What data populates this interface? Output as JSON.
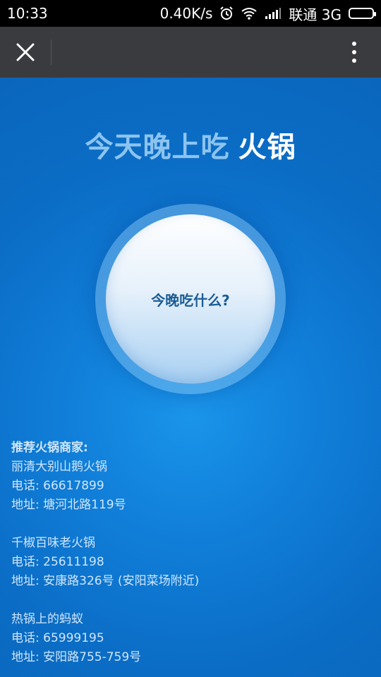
{
  "status_bar": {
    "time": "10:33",
    "speed": "0.40K/s",
    "carrier": "联通 3G"
  },
  "app_bar": {
    "close_icon": "close-icon",
    "more_icon": "more-vertical-icon"
  },
  "headline": {
    "prefix": "今天晚上吃",
    "food": "火锅"
  },
  "circle_button": {
    "label": "今晚吃什么?"
  },
  "recommendations": {
    "title": "推荐火锅商家:",
    "shops": [
      {
        "name": "丽清大别山鹅火锅",
        "phone": "电话: 66617899",
        "address": "地址: 塘河北路119号"
      },
      {
        "name": "千椒百味老火锅",
        "phone": "电话: 25611198",
        "address": "地址: 安康路326号 (安阳菜场附近)"
      },
      {
        "name": "热锅上的蚂蚁",
        "phone": "电话: 65999195",
        "address": "地址: 安阳路755-759号"
      }
    ]
  },
  "colors": {
    "background": "#0a6fc7",
    "app_bar": "#3a3b3e",
    "headline_prefix": "#8cc4ef"
  }
}
